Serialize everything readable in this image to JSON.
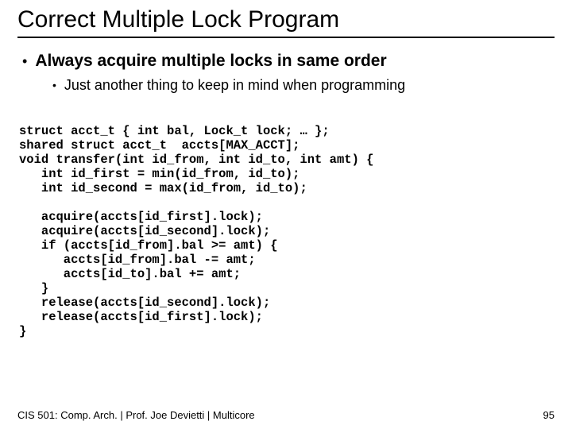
{
  "title": "Correct Multiple Lock Program",
  "bullets": {
    "l1": "Always acquire multiple locks in same order",
    "l2": "Just another thing to keep in mind when programming"
  },
  "code": "struct acct_t { int bal, Lock_t lock; … };\nshared struct acct_t  accts[MAX_ACCT];\nvoid transfer(int id_from, int id_to, int amt) {\n   int id_first = min(id_from, id_to);\n   int id_second = max(id_from, id_to);\n\n   acquire(accts[id_first].lock);\n   acquire(accts[id_second].lock);\n   if (accts[id_from].bal >= amt) {\n      accts[id_from].bal -= amt;\n      accts[id_to].bal += amt;\n   }\n   release(accts[id_second].lock);\n   release(accts[id_first].lock);\n}",
  "footer": {
    "left": "CIS 501: Comp. Arch.  |  Prof. Joe Devietti  |  Multicore",
    "pageno": "95"
  }
}
